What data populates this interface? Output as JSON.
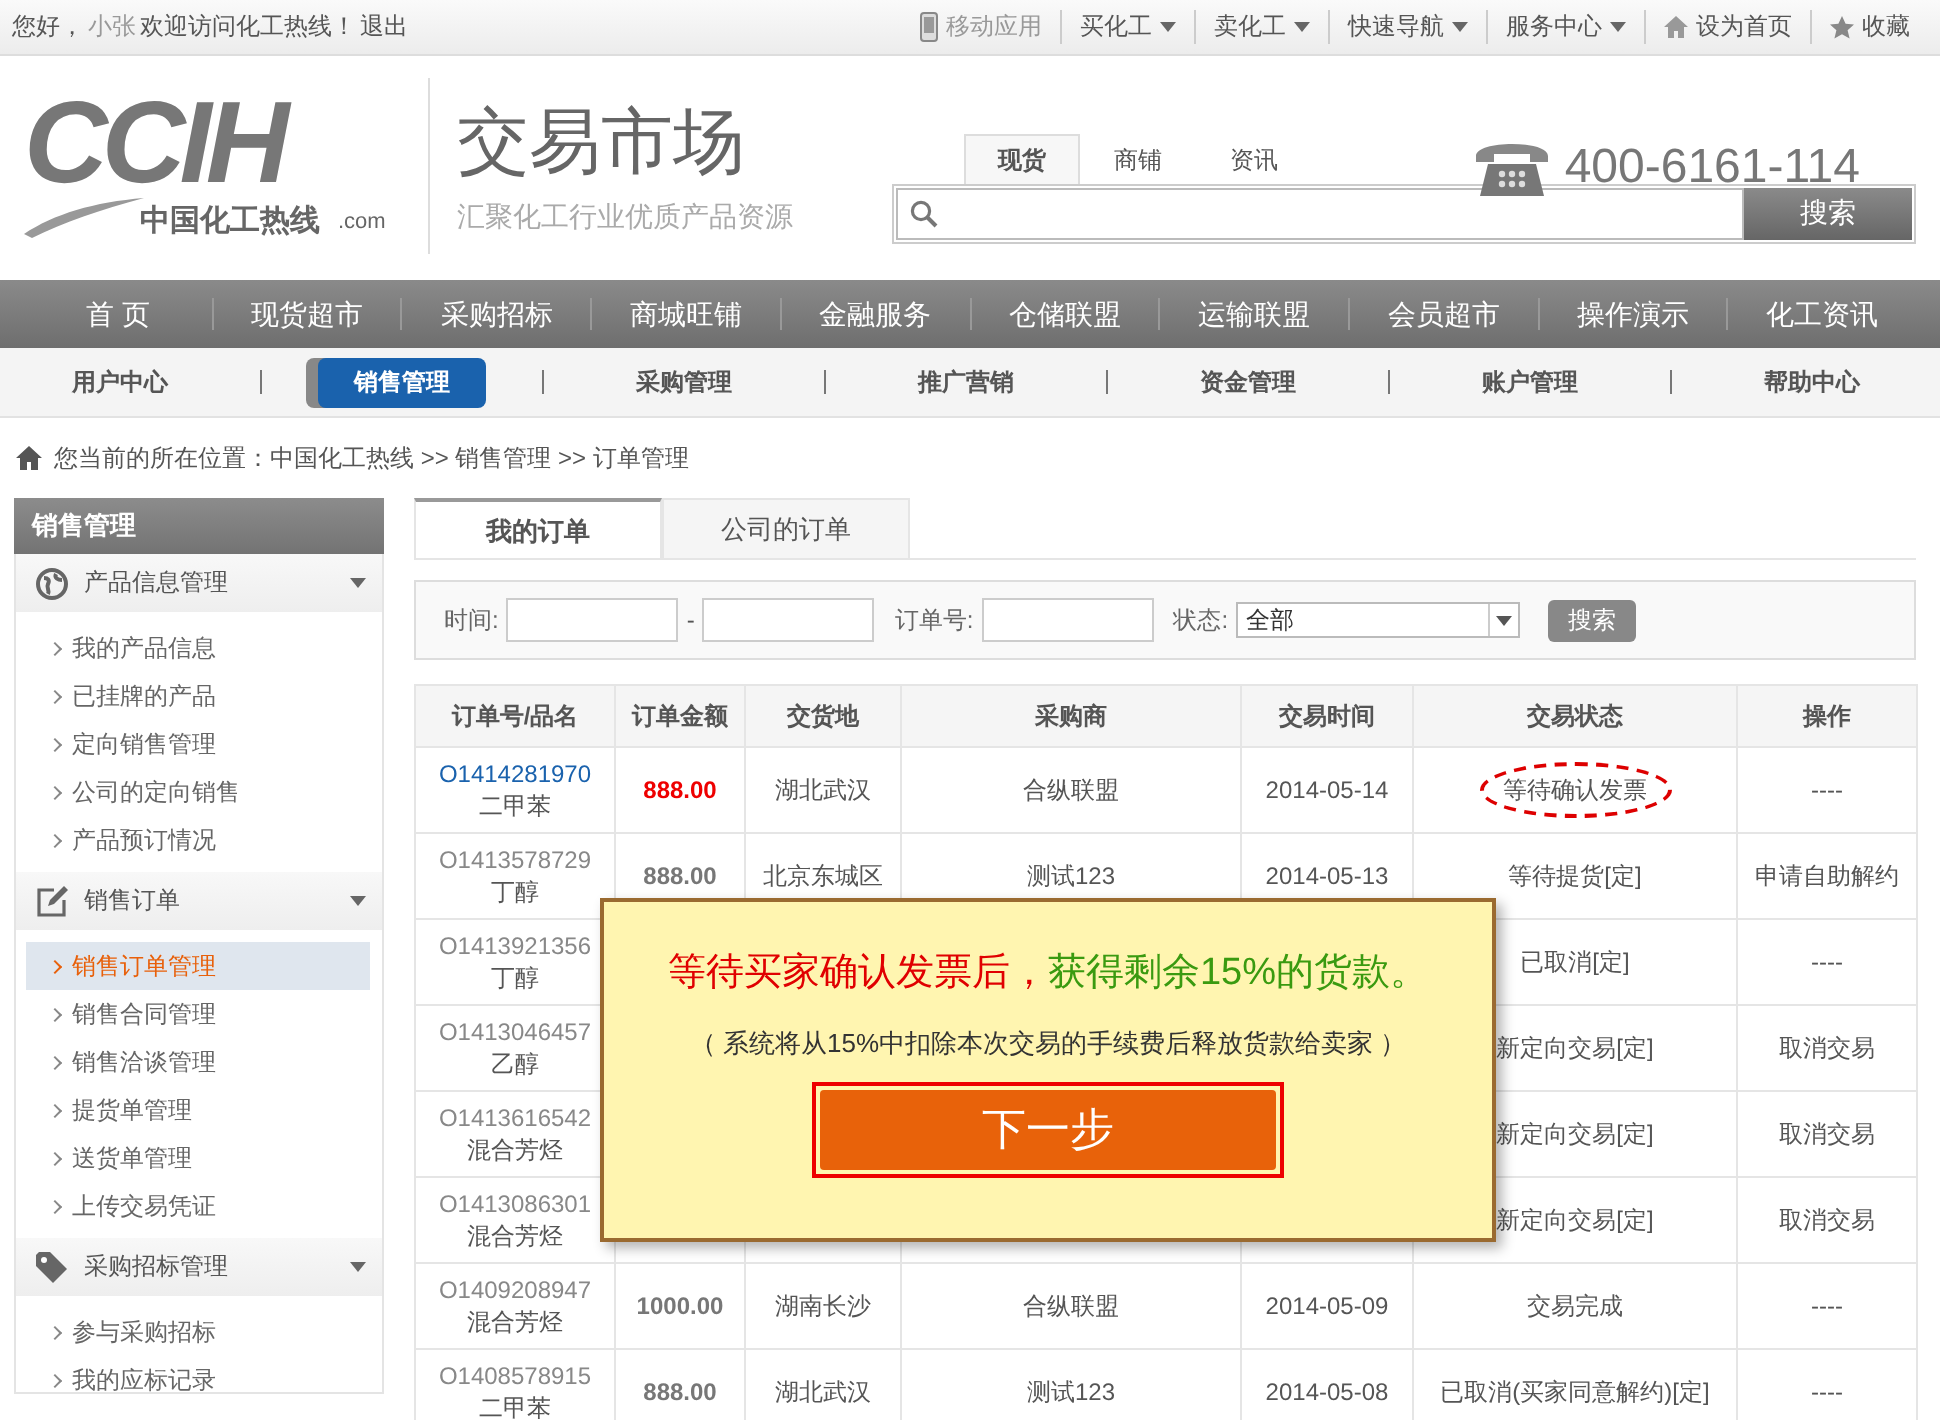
{
  "top_bar": {
    "greeting": "您好，",
    "user": "小张",
    "welcome": "欢迎访问化工热线！",
    "logout": "退出",
    "links": [
      {
        "label": "移动应用",
        "kind": "mobile"
      },
      {
        "label": "买化工",
        "kind": "menu"
      },
      {
        "label": "卖化工",
        "kind": "menu"
      },
      {
        "label": "快速导航",
        "kind": "menu"
      },
      {
        "label": "服务中心",
        "kind": "menu"
      },
      {
        "label": "设为首页",
        "kind": "home"
      },
      {
        "label": "收藏",
        "kind": "star"
      }
    ]
  },
  "header": {
    "logo": {
      "mark": "CCIH",
      "name": "中国化工热线",
      "suffix": ".com"
    },
    "title": "交易市场",
    "subtitle": "汇聚化工行业优质产品资源",
    "search_tabs": [
      {
        "label": "现货",
        "selected": true
      },
      {
        "label": "商铺",
        "selected": false
      },
      {
        "label": "资讯",
        "selected": false
      }
    ],
    "search_button": "搜索",
    "hotline": "400-6161-114"
  },
  "main_nav": [
    "首 页",
    "现货超市",
    "采购招标",
    "商城旺铺",
    "金融服务",
    "仓储联盟",
    "运输联盟",
    "会员超市",
    "操作演示",
    "化工资讯"
  ],
  "sub_nav": [
    {
      "label": "用户中心",
      "selected": false
    },
    {
      "label": "销售管理",
      "selected": true
    },
    {
      "label": "采购管理",
      "selected": false
    },
    {
      "label": "推广营销",
      "selected": false
    },
    {
      "label": "资金管理",
      "selected": false
    },
    {
      "label": "账户管理",
      "selected": false
    },
    {
      "label": "帮助中心",
      "selected": false
    }
  ],
  "breadcrumb": "您当前的所在位置：中国化工热线 >> 销售管理 >> 订单管理",
  "sidebar": {
    "title": "销售管理",
    "groups": [
      {
        "title": "产品信息管理",
        "kind": "globe",
        "expanded": true,
        "items": [
          {
            "label": "我的产品信息",
            "selected": false
          },
          {
            "label": "已挂牌的产品",
            "selected": false
          },
          {
            "label": "定向销售管理",
            "selected": false
          },
          {
            "label": "公司的定向销售",
            "selected": false
          },
          {
            "label": "产品预订情况",
            "selected": false
          }
        ]
      },
      {
        "title": "销售订单",
        "kind": "edit",
        "expanded": true,
        "items": [
          {
            "label": "销售订单管理",
            "selected": true
          },
          {
            "label": "销售合同管理",
            "selected": false
          },
          {
            "label": "销售洽谈管理",
            "selected": false
          },
          {
            "label": "提货单管理",
            "selected": false
          },
          {
            "label": "送货单管理",
            "selected": false
          },
          {
            "label": "上传交易凭证",
            "selected": false
          }
        ]
      },
      {
        "title": "采购招标管理",
        "kind": "tag",
        "expanded": true,
        "items": [
          {
            "label": "参与采购招标",
            "selected": false
          },
          {
            "label": "我的应标记录",
            "selected": false
          }
        ]
      }
    ]
  },
  "order_tabs": [
    {
      "label": "我的订单",
      "selected": true
    },
    {
      "label": "公司的订单",
      "selected": false
    }
  ],
  "filter": {
    "time_label": "时间:",
    "dash": "-",
    "order_label": "订单号:",
    "status_label": "状态:",
    "status_value": "全部",
    "search_button": "搜索"
  },
  "table": {
    "columns": [
      "订单号/品名",
      "订单金额",
      "交货地",
      "采购商",
      "交易时间",
      "交易状态",
      "操作"
    ],
    "rows": [
      {
        "order_no": "O1414281970",
        "product": "二甲苯",
        "amount": "888.00",
        "location": "湖北武汉",
        "buyer": "合纵联盟",
        "date": "2014-05-14",
        "status": "等待确认发票",
        "action": "----",
        "current": true
      },
      {
        "order_no": "O1413578729",
        "product": "丁醇",
        "amount": "888.00",
        "location": "北京东城区",
        "buyer": "测试123",
        "date": "2014-05-13",
        "status": "等待提货[定]",
        "action": "申请自助解约",
        "current": false
      },
      {
        "order_no": "O1413921356",
        "product": "丁醇",
        "status": "已取消[定]",
        "action": "----",
        "current": false
      },
      {
        "order_no": "O1413046457",
        "product": "乙醇",
        "status": "新定向交易[定]",
        "action": "取消交易",
        "current": false
      },
      {
        "order_no": "O1413616542",
        "product": "混合芳烃",
        "status": "新定向交易[定]",
        "action": "取消交易",
        "current": false
      },
      {
        "order_no": "O1413086301",
        "product": "混合芳烃",
        "status": "新定向交易[定]",
        "action": "取消交易",
        "current": false
      },
      {
        "order_no": "O1409208947",
        "product": "混合芳烃",
        "amount": "1000.00",
        "location": "湖南长沙",
        "buyer": "合纵联盟",
        "date": "2014-05-09",
        "status": "交易完成",
        "action": "----",
        "current": false
      },
      {
        "order_no": "O1408578915",
        "product": "二甲苯",
        "amount": "888.00",
        "location": "湖北武汉",
        "buyer": "测试123",
        "date": "2014-05-08",
        "status": "已取消(买家同意解约)[定]",
        "action": "----",
        "current": false
      }
    ]
  },
  "modal": {
    "title_parts": [
      {
        "text": "等待买家确认发票后，",
        "kind": "warning"
      },
      {
        "text": "获得剩余15%的货款。",
        "kind": "benefit"
      }
    ],
    "note": "（ 系统将从15%中扣除本次交易的手续费后释放货款给卖家 ）",
    "button": "下一步"
  }
}
